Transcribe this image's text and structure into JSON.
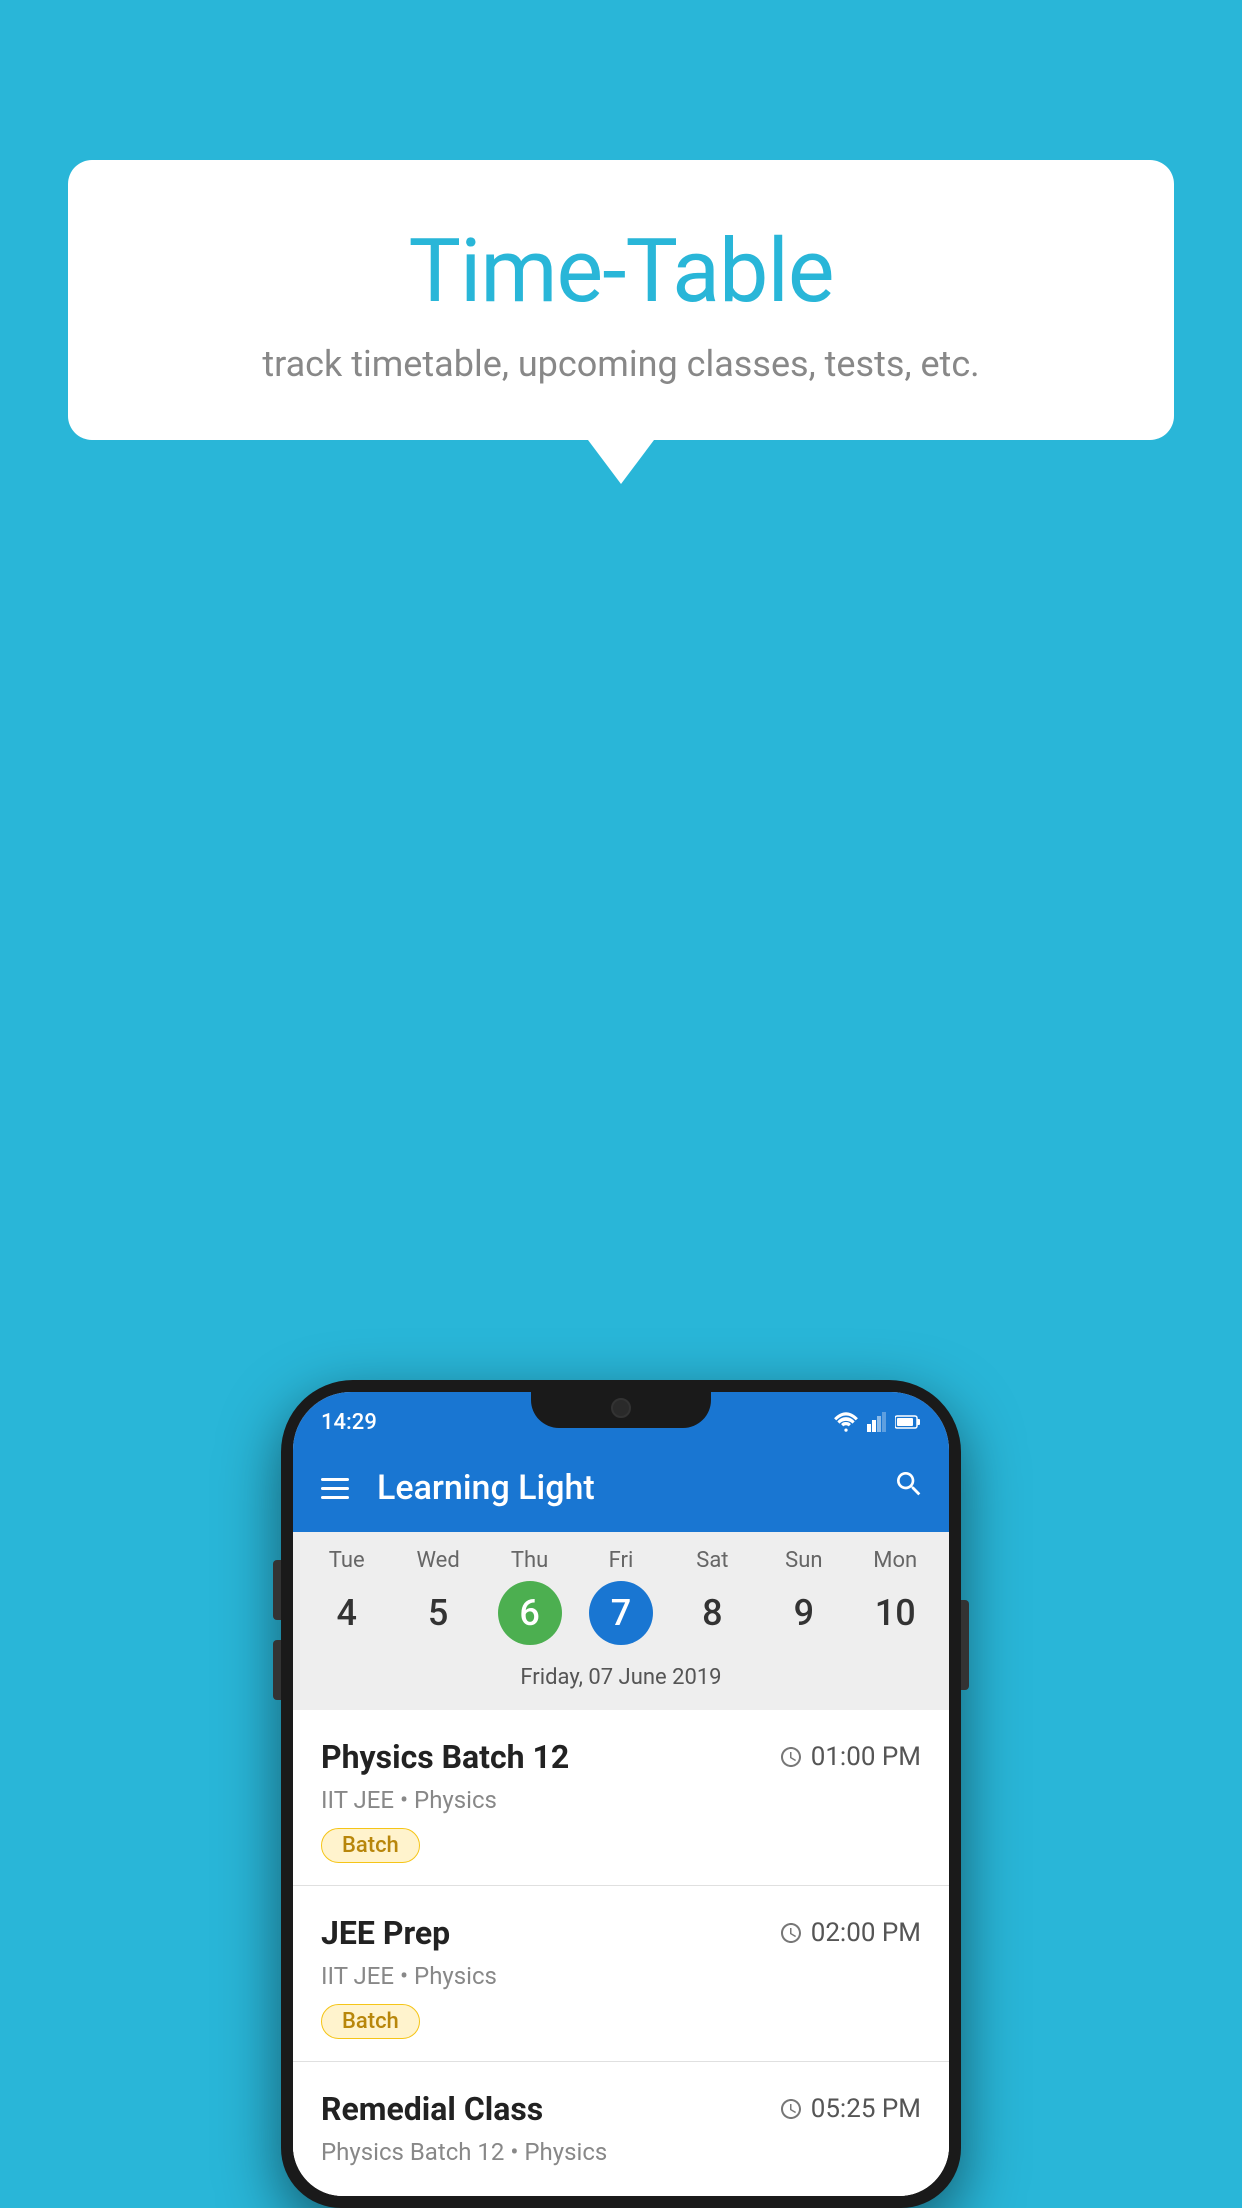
{
  "background_color": "#29B6D8",
  "bubble": {
    "title": "Time-Table",
    "subtitle": "track timetable, upcoming classes, tests, etc."
  },
  "phone": {
    "status_bar": {
      "time": "14:29"
    },
    "app_bar": {
      "title": "Learning Light"
    },
    "calendar": {
      "days": [
        {
          "name": "Tue",
          "num": "4",
          "state": "normal"
        },
        {
          "name": "Wed",
          "num": "5",
          "state": "normal"
        },
        {
          "name": "Thu",
          "num": "6",
          "state": "today"
        },
        {
          "name": "Fri",
          "num": "7",
          "state": "selected"
        },
        {
          "name": "Sat",
          "num": "8",
          "state": "normal"
        },
        {
          "name": "Sun",
          "num": "9",
          "state": "normal"
        },
        {
          "name": "Mon",
          "num": "10",
          "state": "normal"
        }
      ],
      "selected_date_label": "Friday, 07 June 2019"
    },
    "schedule": [
      {
        "title": "Physics Batch 12",
        "time": "01:00 PM",
        "subtitle": "IIT JEE • Physics",
        "tag": "Batch"
      },
      {
        "title": "JEE Prep",
        "time": "02:00 PM",
        "subtitle": "IIT JEE • Physics",
        "tag": "Batch"
      },
      {
        "title": "Remedial Class",
        "time": "05:25 PM",
        "subtitle": "Physics Batch 12 • Physics",
        "tag": null
      }
    ]
  }
}
